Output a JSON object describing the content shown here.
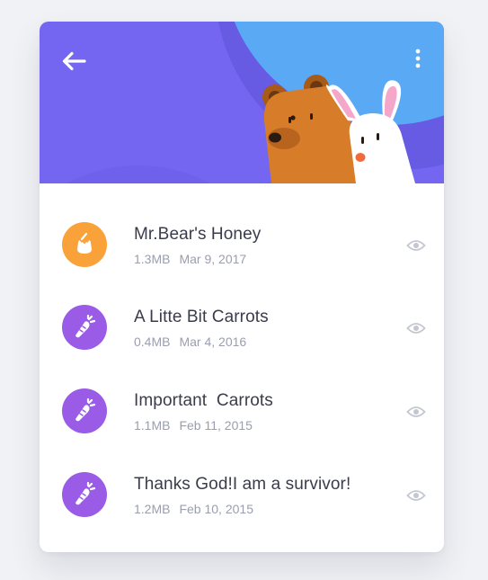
{
  "colors": {
    "header_purple": "#7466f0",
    "header_blue": "#5aa9f5",
    "honey_orange": "#f9a23a",
    "carrot_purple": "#9a5be6",
    "title_text": "#3a3c4b",
    "meta_text": "#9a9eae"
  },
  "header": {
    "back_icon": "arrow-left-icon",
    "menu_icon": "more-vertical-icon",
    "illustration": "bear-and-bunny"
  },
  "files": [
    {
      "icon": "honey-pot-icon",
      "color": "#f9a23a",
      "title": "Mr.Bear's Honey",
      "size": "1.3MB",
      "date": "Mar 9, 2017",
      "action_icon": "eye-icon"
    },
    {
      "icon": "carrot-icon",
      "color": "#9a5be6",
      "title": "A Litte Bit Carrots",
      "size": "0.4MB",
      "date": "Mar 4, 2016",
      "action_icon": "eye-icon"
    },
    {
      "icon": "carrot-icon",
      "color": "#9a5be6",
      "title": "Important  Carrots",
      "size": "1.1MB",
      "date": "Feb 11, 2015",
      "action_icon": "eye-icon"
    },
    {
      "icon": "carrot-icon",
      "color": "#9a5be6",
      "title": "Thanks God!I am a survivor!",
      "size": "1.2MB",
      "date": "Feb 10, 2015",
      "action_icon": "eye-icon"
    }
  ]
}
